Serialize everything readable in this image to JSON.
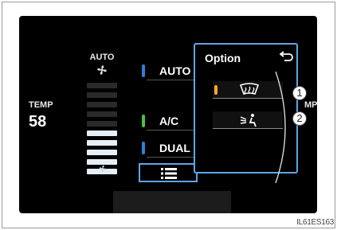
{
  "fan": {
    "auto_label": "AUTO",
    "top_icon": "fan-large-icon",
    "bottom_icon": "fan-small-icon",
    "level": 5,
    "max_level": 10
  },
  "temp": {
    "label": "TEMP",
    "value": "58"
  },
  "buttons": {
    "auto": {
      "label": "AUTO",
      "indicator_color": "#2f7fd8"
    },
    "ac": {
      "label": "A/C",
      "indicator_color": "#4bbf4b"
    },
    "dual": {
      "label": "DUAL",
      "indicator_color": "#2f7fd8"
    }
  },
  "option": {
    "title": "Option",
    "back_icon": "back-arrow-icon",
    "items": [
      {
        "icon": "windshield-defogger-icon",
        "indicator_color": "#ffa82a"
      },
      {
        "icon": "air-outlet-person-icon"
      }
    ]
  },
  "menu_button": {
    "icon": "list-menu-icon"
  },
  "right_edge_text": "MP",
  "callouts": [
    "1",
    "2"
  ],
  "figure_code": "IL61ES163",
  "colors": {
    "accent_border": "#5da6e6",
    "screen_bg": "#000000"
  }
}
